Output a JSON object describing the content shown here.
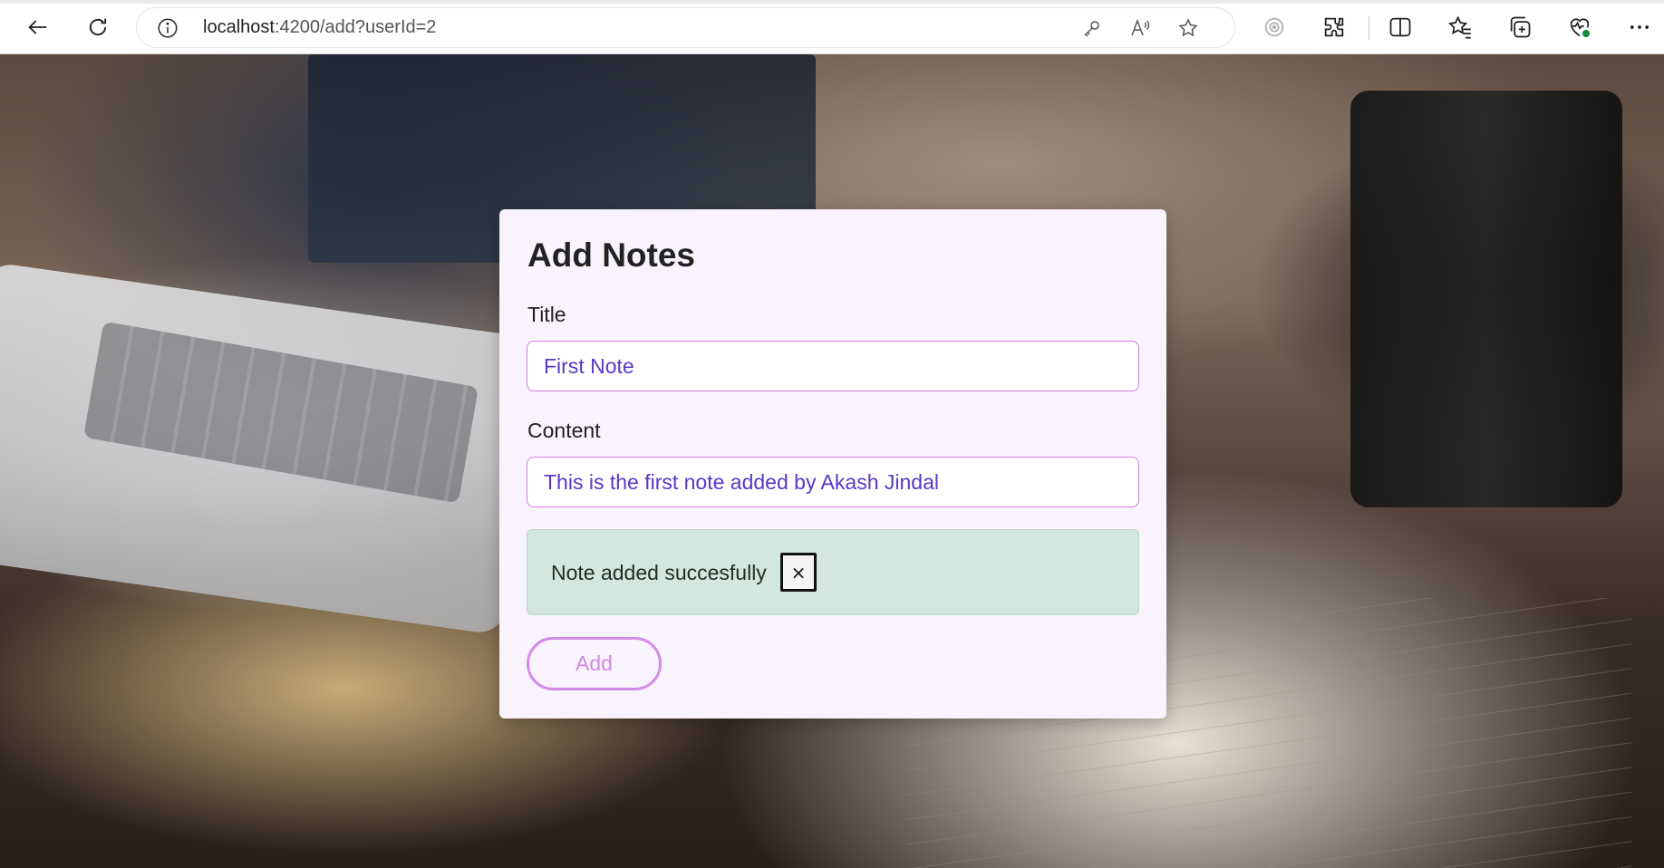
{
  "browser": {
    "url_host": "localhost",
    "url_path": ":4200/add?userId=2",
    "toolbar_icons": [
      "back-arrow-icon",
      "refresh-icon",
      "info-icon",
      "key-icon",
      "read-aloud-icon",
      "favorite-star-icon",
      "tracking-icon",
      "extensions-icon",
      "split-screen-icon",
      "favorites-icon",
      "collections-icon",
      "browser-essentials-icon",
      "more-menu-icon"
    ]
  },
  "card": {
    "heading": "Add Notes",
    "title_label": "Title",
    "title_value": "First Note",
    "content_label": "Content",
    "content_value": "This is the first note added by Akash Jindal",
    "alert_message": "Note added succesfully",
    "alert_close": "×",
    "add_button": "Add"
  },
  "colors": {
    "card_bg": "#f8f3fd",
    "input_border": "#d679e6",
    "input_text": "#5a37c6",
    "alert_bg": "#d2e8de",
    "button_accent": "#d58ae8"
  }
}
